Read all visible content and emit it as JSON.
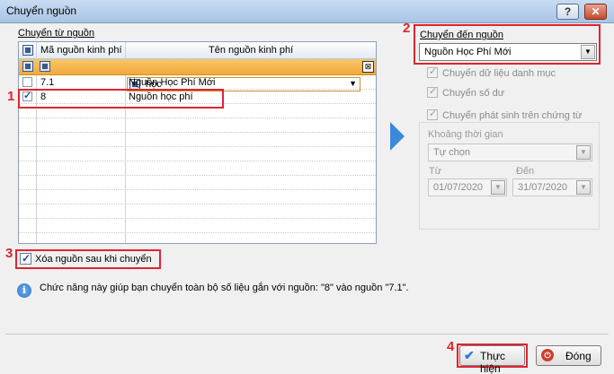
{
  "window": {
    "title": "Chuyển nguồn",
    "help_label": "?",
    "close_label": "✕"
  },
  "left": {
    "section_label": "Chuyển từ nguồn",
    "columns": [
      "Mã nguồn kinh phí",
      "Tên nguồn kinh phí"
    ],
    "filter_value": "học",
    "rows": [
      {
        "checked": false,
        "code": "7.1",
        "name": "Nguồn Học Phí Mới"
      },
      {
        "checked": true,
        "code": "8",
        "name": "Nguồn học phí"
      }
    ],
    "delete_checkbox_label": "Xóa nguồn sau khi chuyển",
    "delete_checked": true
  },
  "right": {
    "section_label": "Chuyển đến nguồn",
    "target_value": "Nguồn Học Phí Mới",
    "options": [
      "Chuyển dữ liệu danh mục",
      "Chuyển số dư",
      "Chuyển phát sinh trên chứng từ"
    ],
    "period_label": "Khoảng thời gian",
    "period_value": "Tự chọn",
    "from_label": "Từ",
    "to_label": "Đến",
    "from_value": "01/07/2020",
    "to_value": "31/07/2020"
  },
  "info_text": "Chức năng này giúp bạn chuyển toàn bộ số liệu gắn với nguồn: \"8\" vào nguồn \"7.1\".",
  "buttons": {
    "execute": "Thực hiện",
    "close": "Đóng"
  },
  "annotations": [
    "1",
    "2",
    "3",
    "4"
  ],
  "colors": {
    "annotation": "#e0242f",
    "filter_row": "#f3a83b",
    "arrow": "#3b8ad9"
  }
}
